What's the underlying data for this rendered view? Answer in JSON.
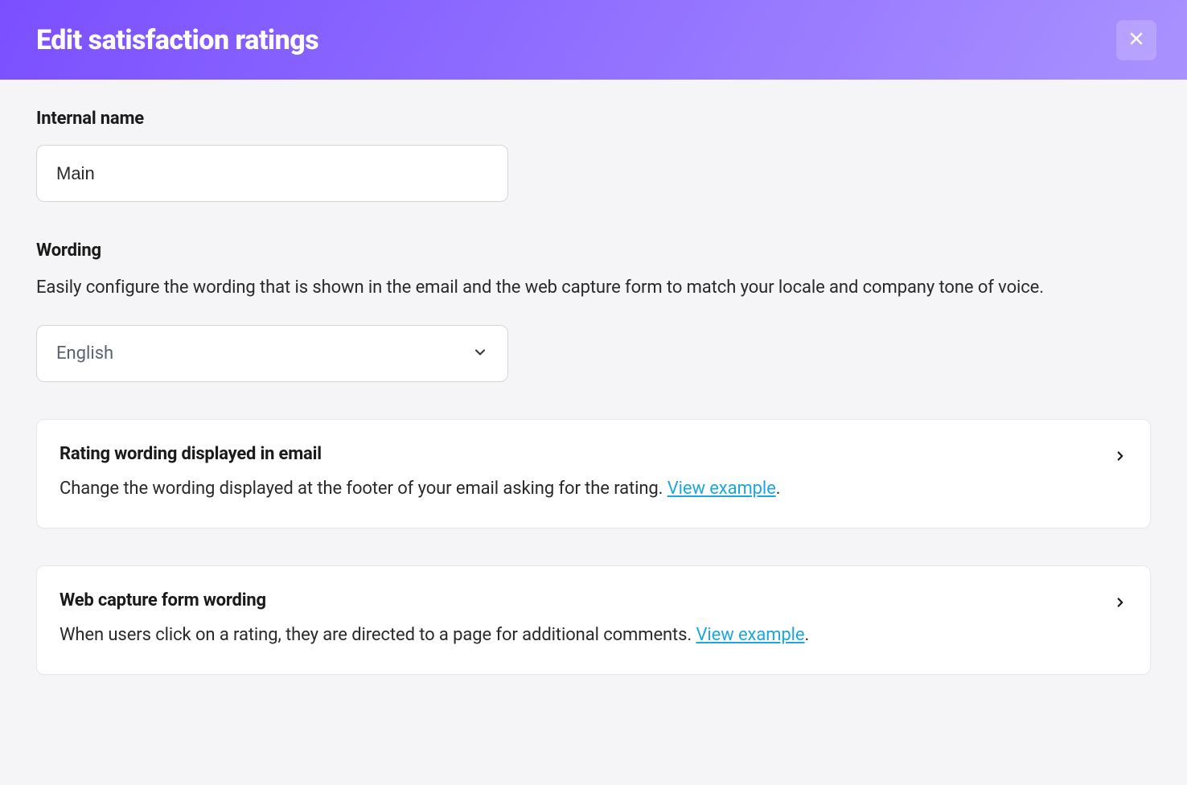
{
  "header": {
    "title": "Edit satisfaction ratings"
  },
  "internalName": {
    "label": "Internal name",
    "value": "Main"
  },
  "wording": {
    "label": "Wording",
    "description": "Easily configure the wording that is shown in the email and the web capture form to match your locale and company tone of voice.",
    "languageSelect": "English"
  },
  "cards": {
    "email": {
      "title": "Rating wording displayed in email",
      "description": "Change the wording displayed at the footer of your email asking for the rating. ",
      "linkText": "View example",
      "period": "."
    },
    "webCapture": {
      "title": "Web capture form wording",
      "description": "When users click on a rating, they are directed to a page for additional comments. ",
      "linkText": "View example",
      "period": "."
    }
  }
}
